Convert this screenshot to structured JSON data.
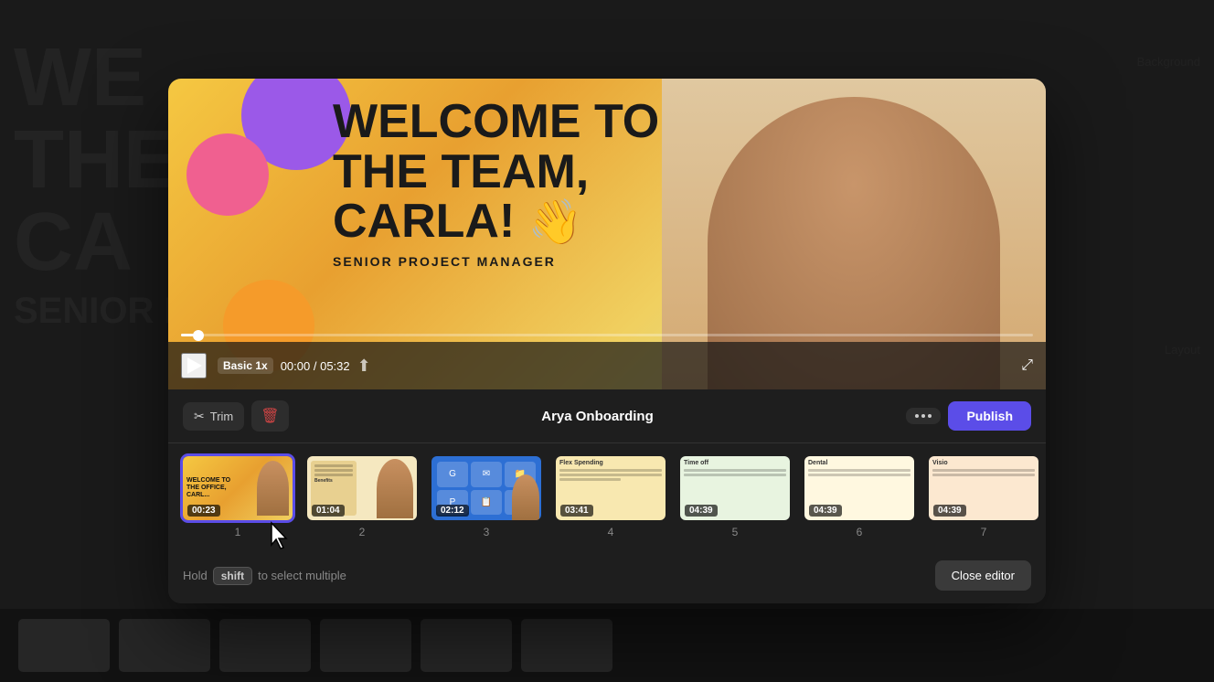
{
  "background": {
    "main_text_line1": "WE",
    "main_text_line2": "THE",
    "main_text_line3": "CA",
    "right_label": "Background",
    "bottom_label": "Layout",
    "senior_text": "SENIOR P"
  },
  "video": {
    "speed_label": "Basic 1x",
    "time_current": "00:00",
    "time_total": "05:32",
    "progress_percent": 2
  },
  "toolbar": {
    "trim_label": "Trim",
    "title": "Arya Onboarding",
    "publish_label": "Publish"
  },
  "slides": [
    {
      "number": "1",
      "duration": "00:23",
      "label": "Welcome slide",
      "selected": true
    },
    {
      "number": "2",
      "duration": "01:04",
      "label": "Benefits slide"
    },
    {
      "number": "3",
      "duration": "02:12",
      "label": "Apps slide"
    },
    {
      "number": "4",
      "duration": "03:41",
      "label": "Flex Spending slide"
    },
    {
      "number": "5",
      "duration": "04:39",
      "label": "Time off slide"
    },
    {
      "number": "6",
      "duration": "04:39",
      "label": "Dental slide"
    },
    {
      "number": "7",
      "duration": "04:39",
      "label": "Vision slide"
    }
  ],
  "slide_thumbnails": {
    "slide4_header": "Flex Spending",
    "slide5_header": "Time off",
    "slide6_header": "Dental",
    "slide7_header": "Visio"
  },
  "footer": {
    "hold_text": "Hold",
    "shift_key": "shift",
    "to_select": "to select multiple",
    "close_label": "Close editor"
  }
}
